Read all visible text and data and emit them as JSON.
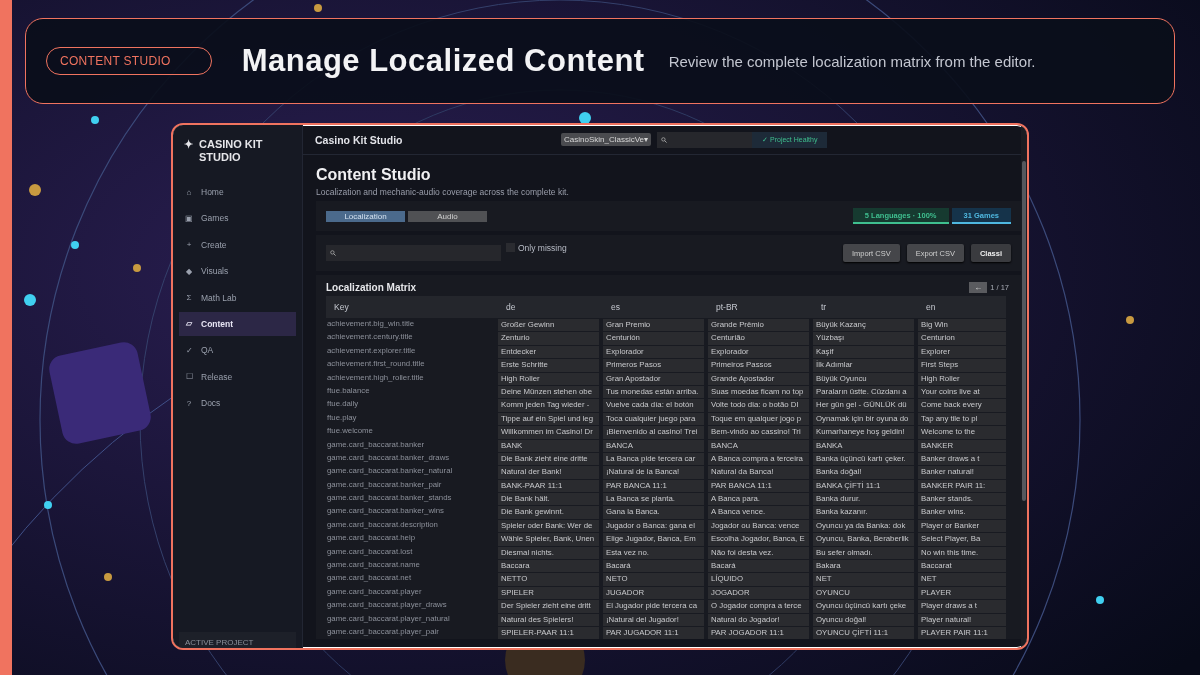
{
  "header": {
    "badge": "CONTENT STUDIO",
    "title": "Manage Localized Content",
    "subtitle": "Review the complete localization matrix from the editor."
  },
  "app": {
    "brand": {
      "icon": "✦",
      "name": "CASINO KIT STUDIO"
    },
    "sidebar": {
      "items": [
        {
          "icon": "⌂",
          "label": "Home",
          "selected": false
        },
        {
          "icon": "▣",
          "label": "Games",
          "selected": false
        },
        {
          "icon": "+",
          "label": "Create",
          "selected": false
        },
        {
          "icon": "◆",
          "label": "Visuals",
          "selected": false
        },
        {
          "icon": "Σ",
          "label": "Math Lab",
          "selected": false
        },
        {
          "icon": "▱",
          "label": "Content",
          "selected": true
        },
        {
          "icon": "✓",
          "label": "QA",
          "selected": false
        },
        {
          "icon": "☐",
          "label": "Release",
          "selected": false
        },
        {
          "icon": "?",
          "label": "Docs",
          "selected": false
        }
      ],
      "footer": "ACTIVE PROJECT"
    },
    "topbar": {
      "title": "Casino Kit Studio",
      "project": "CasinoSkin_ClassicVe▾",
      "status": "✓ Project Healthy"
    },
    "page": {
      "title": "Content Studio",
      "subtitle": "Localization and mechanic-audio coverage across the complete kit.",
      "tabs": [
        {
          "label": "Localization",
          "selected": true
        },
        {
          "label": "Audio",
          "selected": false
        }
      ],
      "stats": [
        {
          "label": "5 Languages · 100%",
          "color": "#3fbf8f"
        },
        {
          "label": "31 Games",
          "color": "#4fb8e0"
        }
      ],
      "filter": {
        "only_missing": {
          "label": "Only missing",
          "checked": false
        },
        "buttons": [
          {
            "label": "Import CSV",
            "kind": "normal"
          },
          {
            "label": "Export CSV",
            "kind": "normal"
          },
          {
            "label": "Classi",
            "kind": "strong"
          }
        ]
      },
      "matrix": {
        "title": "Localization Matrix",
        "prev": "←",
        "pager": "1 / 17",
        "columns": [
          "Key",
          "de",
          "es",
          "pt-BR",
          "tr",
          "en"
        ],
        "rows": [
          [
            "achievement.big_win.title",
            "Großer Gewinn",
            "Gran Premio",
            "Grande Prêmio",
            "Büyük Kazanç",
            "Big Win"
          ],
          [
            "achievement.century.title",
            "Zenturio",
            "Centurión",
            "Centurião",
            "Yüzbaşı",
            "Centurion"
          ],
          [
            "achievement.explorer.title",
            "Entdecker",
            "Explorador",
            "Explorador",
            "Kaşif",
            "Explorer"
          ],
          [
            "achievement.first_round.title",
            "Erste Schritte",
            "Primeros Pasos",
            "Primeiros Passos",
            "İlk Adımlar",
            "First Steps"
          ],
          [
            "achievement.high_roller.title",
            "High Roller",
            "Gran Apostador",
            "Grande Apostador",
            "Büyük Oyuncu",
            "High Roller"
          ],
          [
            "ftue.balance",
            "Deine Münzen stehen obe",
            "Tus monedas están arriba.",
            "Suas moedas ficam no top",
            "Paraların üstte. Cüzdanı a",
            "Your coins live at"
          ],
          [
            "ftue.daily",
            "Komm jeden Tag wieder -",
            "Vuelve cada día: el botón",
            "Volte todo dia: o botão DI",
            "Her gün gel - GÜNLÜK dü",
            "Come back every"
          ],
          [
            "ftue.play",
            "Tippe auf ein Spiel und leg",
            "Toca cualquier juego para",
            "Toque em qualquer jogo p",
            "Oynamak için bir oyuna do",
            "Tap any tile to pl"
          ],
          [
            "ftue.welcome",
            "Willkommen im Casino! Dr",
            "¡Bienvenido al casino! Trei",
            "Bem-vindo ao cassino! Tri",
            "Kumarhaneye hoş geldin!",
            "Welcome to the"
          ],
          [
            "game.card_baccarat.banker",
            "BANK",
            "BANCA",
            "BANCA",
            "BANKA",
            "BANKER"
          ],
          [
            "game.card_baccarat.banker_draws",
            "Die Bank zieht eine dritte",
            "La Banca pide tercera car",
            "A Banca compra a terceira",
            "Banka üçüncü kartı çeker.",
            "Banker draws a t"
          ],
          [
            "game.card_baccarat.banker_natural",
            "Natural der Bank!",
            "¡Natural de la Banca!",
            "Natural da Banca!",
            "Banka doğal!",
            "Banker natural!"
          ],
          [
            "game.card_baccarat.banker_pair",
            "BANK-PAAR 11:1",
            "PAR BANCA 11:1",
            "PAR BANCA 11:1",
            "BANKA ÇİFTİ 11:1",
            "BANKER PAIR 11:"
          ],
          [
            "game.card_baccarat.banker_stands",
            "Die Bank hält.",
            "La Banca se planta.",
            "A Banca para.",
            "Banka durur.",
            "Banker stands."
          ],
          [
            "game.card_baccarat.banker_wins",
            "Die Bank gewinnt.",
            "Gana la Banca.",
            "A Banca vence.",
            "Banka kazanır.",
            "Banker wins."
          ],
          [
            "game.card_baccarat.description",
            "Spieler oder Bank: Wer de",
            "Jugador o Banca: gana el",
            "Jogador ou Banca: vence",
            "Oyuncu ya da Banka: dok",
            "Player or Banker"
          ],
          [
            "game.card_baccarat.help",
            "Wähle Spieler, Bank, Unen",
            "Elige Jugador, Banca, Em",
            "Escolha Jogador, Banca, E",
            "Oyuncu, Banka, Beraberlik",
            "Select Player, Ba"
          ],
          [
            "game.card_baccarat.lost",
            "Diesmal nichts.",
            "Esta vez no.",
            "Não foi desta vez.",
            "Bu sefer olmadı.",
            "No win this time."
          ],
          [
            "game.card_baccarat.name",
            "Baccara",
            "Bacará",
            "Bacará",
            "Bakara",
            "Baccarat"
          ],
          [
            "game.card_baccarat.net",
            "NETTO",
            "NETO",
            "LÍQUIDO",
            "NET",
            "NET"
          ],
          [
            "game.card_baccarat.player",
            "SPIELER",
            "JUGADOR",
            "JOGADOR",
            "OYUNCU",
            "PLAYER"
          ],
          [
            "game.card_baccarat.player_draws",
            "Der Spieler zieht eine dritt",
            "El Jugador pide tercera ca",
            "O Jogador compra a terce",
            "Oyuncu üçüncü kartı çeke",
            "Player draws a t"
          ],
          [
            "game.card_baccarat.player_natural",
            "Natural des Spielers!",
            "¡Natural del Jugador!",
            "Natural do Jogador!",
            "Oyuncu doğal!",
            "Player natural!"
          ],
          [
            "game.card_baccarat.player_pair",
            "SPIELER-PAAR 11:1",
            "PAR JUGADOR 11:1",
            "PAR JOGADOR 11:1",
            "OYUNCU ÇİFTİ 11:1",
            "PLAYER PAIR 11:1"
          ]
        ]
      }
    }
  }
}
